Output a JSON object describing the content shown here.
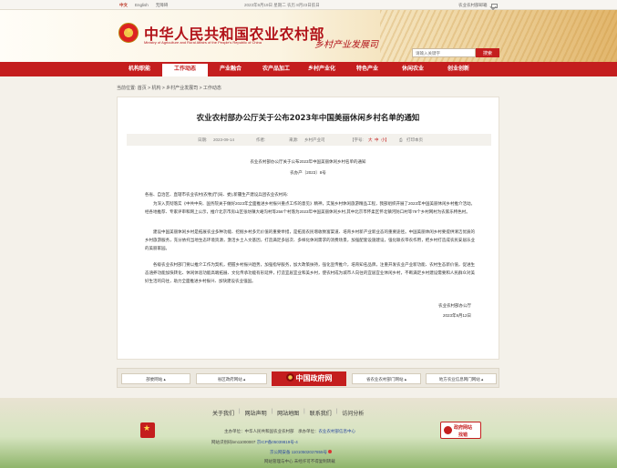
{
  "topbar": {
    "lang_cn": "中文",
    "lang_en": "English",
    "accessibility": "无障碍",
    "date_text": "2023年9月19日 星期二 农历 8月23日航日",
    "mailbox": "农业农村部邮箱"
  },
  "header": {
    "title": "中华人民共和国农业农村部",
    "subtitle": "Ministry of Agriculture and Rural Affairs of the People's Republic of China",
    "channel": "乡村产业发展司",
    "search_placeholder": "请输入关键字",
    "search_button": "搜索"
  },
  "nav": {
    "items": [
      "机构职能",
      "工作动态",
      "产业融合",
      "农产品加工",
      "乡村产业化",
      "特色产业",
      "休闲农业",
      "创业创新"
    ],
    "active_index": 1
  },
  "breadcrumb": "当前位置: 首页 > 机构 > 乡村产业发展司 > 工作动态",
  "article": {
    "title": "农业农村部办公厅关于公布2023年中国美丽休闲乡村名单的通知",
    "meta": {
      "date_label": "日期:",
      "date": "2023-09-14",
      "author_label": "作者:",
      "source_label": "来源:",
      "source": "乡村产业司",
      "font_label": "【字号:",
      "font_big": "大",
      "font_mid": "中",
      "font_small": "小】",
      "print": "打印本页"
    },
    "doc_title": "农业农村部办公厅关于公布2023年中国美丽休闲乡村名单的通知",
    "doc_number": "农办产〔2023〕8号",
    "salutation": "各省、自治区、直辖市农业农村(农牧)厅(局、委),新疆生产建设兵团农业农村局:",
    "paragraphs": [
      "为深入贯彻落实《中共中央、国务院关于做好2023年全面推进乡村振兴重点工作的意见》精神，实施乡村休闲旅游精品工程，我部组织开展了2023年中国美丽休闲乡村推介活动。经各地推荐、专家评审和网上公示，推介北京市房山区张坊镇大峪沟村等256个村落为2023年中国美丽休闲乡村,其中北京市怀柔区怀北镇河防口村等79个乡村网村为农家乐特色村。",
      "建设中国美丽休闲乡村是拓展农业多种功能、挖掘乡村多元价值的重要举措，是拓宽农民增收致富渠道、培育乡村新产业新业态的重要途径。中国美丽休闲乡村要提供清洁优质的乡村旅游服务，充分依托当地生态环境资源，激活乡土人文基因，打造满足多层次、多样化休闲需求的消费场景，加强配套设施建设，强化联农带农作用，把乡村打造成农民安居乐业的美丽家园。",
      "各级农业农村部门要以推介工作为契机，把握乡村振兴趋势，加强指导服务，加大政策扶持，强化宣传推介，培育知名品牌，注重开发农业产业新功能、农村生态新价值，促进生态涵养功能加快转化、休闲体验功能高端拓展、文化传承功能有形延伸，打造宜居宜业和美乡村，使农村成为城市人向往的宜居宜业休闲乡村，不断满足乡村建设需要和人民群众对美好生活的向往，助力全面推进乡村振兴、加快建设农业强国。"
    ],
    "sign_org": "农业农村部办公厅",
    "sign_date": "2023年9月12日"
  },
  "links_bar": {
    "ministries": "部委网站",
    "provinces": "省区政府网站",
    "gov": "中国政府网",
    "agri_depts": "省农业农村部门网站",
    "local_agri": "地方农业信息网门网站"
  },
  "footer": {
    "links": [
      "关于我们",
      "网站声明",
      "网站地图",
      "联系我们",
      "访问分析"
    ],
    "host_prefix": "主办单位：中华人民共和国农业农村部　承办单位：",
    "host_center": "农业农村部信息中心",
    "record_id": "网站识别码bm11000007",
    "icp": "京ICP备05039819号-4",
    "police": "京公网安备 11010502027855号",
    "best_view": "网站管理与中心 未经许可不得复制转载",
    "err_line1": "政府网站",
    "err_line2": "找错"
  }
}
